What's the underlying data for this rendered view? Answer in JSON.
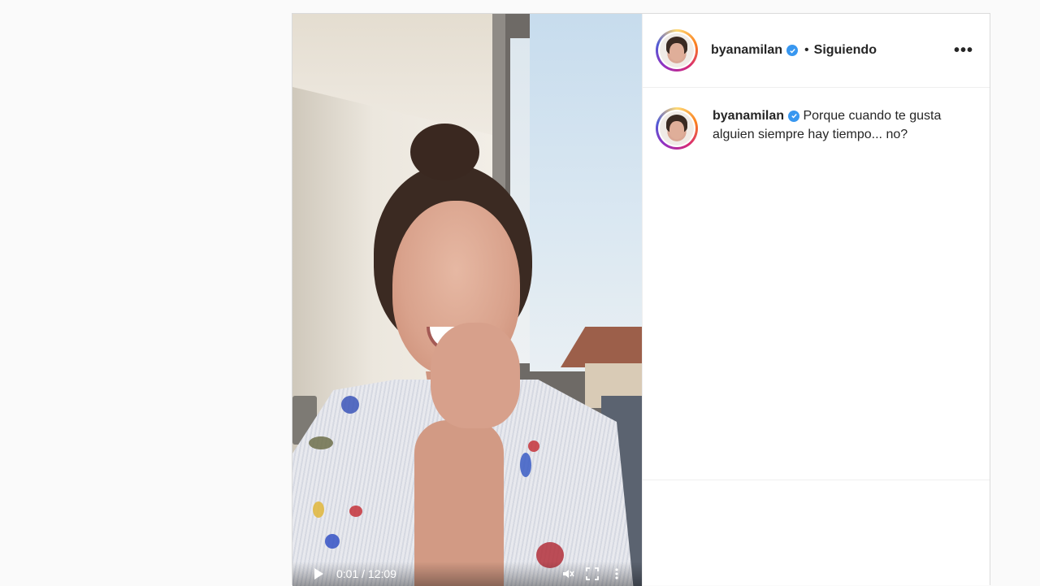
{
  "post": {
    "author": {
      "username": "byanamilan",
      "verified": true,
      "follow_status": "Siguiendo",
      "separator": "•"
    },
    "caption": {
      "username": "byanamilan",
      "text": "Porque cuando te gusta alguien siempre hay tiempo... no?"
    },
    "video": {
      "time": "0:01 / 12:09",
      "icons": [
        "play-icon",
        "mute-icon",
        "fullscreen-icon",
        "more-vertical-icon"
      ]
    },
    "more_options_icon": "more-horizontal-icon"
  },
  "colors": {
    "verified_badge": "#3897f0",
    "text": "#262626",
    "border": "#dbdbdb",
    "background": "#fafafa"
  }
}
